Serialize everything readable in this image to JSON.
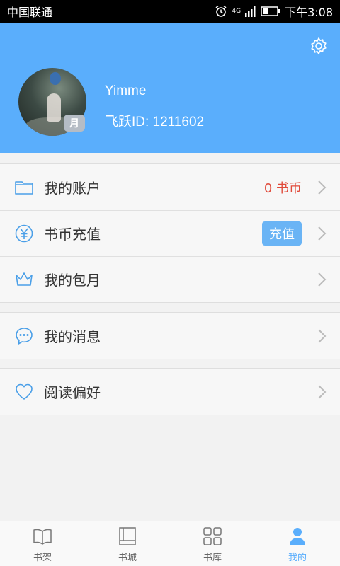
{
  "status_bar": {
    "carrier": "中国联通",
    "network": "4G",
    "time": "下午3:08"
  },
  "profile": {
    "username": "Yimme",
    "user_id": "飞跃ID: 1211602",
    "avatar_badge": "月"
  },
  "menu": {
    "account": {
      "label": "我的账户",
      "value": "0 书币",
      "icon": "folder-icon"
    },
    "recharge": {
      "label": "书币充值",
      "button": "充值",
      "icon": "yen-coin-icon"
    },
    "monthly": {
      "label": "我的包月",
      "icon": "crown-icon"
    },
    "messages": {
      "label": "我的消息",
      "icon": "chat-bubble-icon"
    },
    "preferences": {
      "label": "阅读偏好",
      "icon": "heart-icon"
    }
  },
  "nav": [
    {
      "label": "书架",
      "icon": "open-book-icon",
      "active": false
    },
    {
      "label": "书城",
      "icon": "book-icon",
      "active": false
    },
    {
      "label": "书库",
      "icon": "grid-icon",
      "active": false
    },
    {
      "label": "我的",
      "icon": "person-icon",
      "active": true
    }
  ],
  "colors": {
    "header": "#5aaefc",
    "accent": "#5aaefc",
    "coin": "#e04a3a",
    "icon": "#4a9fe8"
  }
}
